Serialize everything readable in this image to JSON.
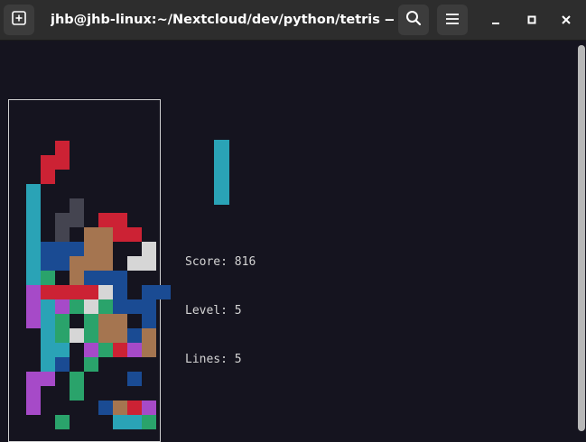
{
  "window": {
    "title": "jhb@jhb-linux:~/Nextcloud/dev/python/tetris — /us..."
  },
  "game": {
    "score_text": "Score: 816",
    "level_text": "Level: 5",
    "lines_text": "Lines: 5",
    "colors": {
      "R": "#cc2234",
      "C": "#2aa3b6",
      "D": "#444450",
      "B": "#1a4b93",
      "O": "#a57550",
      "G": "#2aa36b",
      "W": "#d6d6d6",
      "P": "#a64ac8"
    },
    "board_rows": [
      "..........",
      "..........",
      "..........",
      "...R......",
      "..RR......",
      "..R.......",
      ".C........",
      ".C..D.....",
      ".C.DD.RR..",
      ".C.D.OORR.",
      ".CBBBOO..W",
      ".CBBOOO.WW",
      ".CG.OBBB..",
      ".PRRRRWB.BB",
      ".PCPGWGBBB",
      ".PCG.GOO.B",
      "..CGWGOOBO",
      "..CC.PGRPO",
      "..CB.G....",
      ".PP.G...B.",
      ".P..G.....",
      ".P....BORP",
      "...G...CCG"
    ],
    "next_piece": "I-piece"
  }
}
